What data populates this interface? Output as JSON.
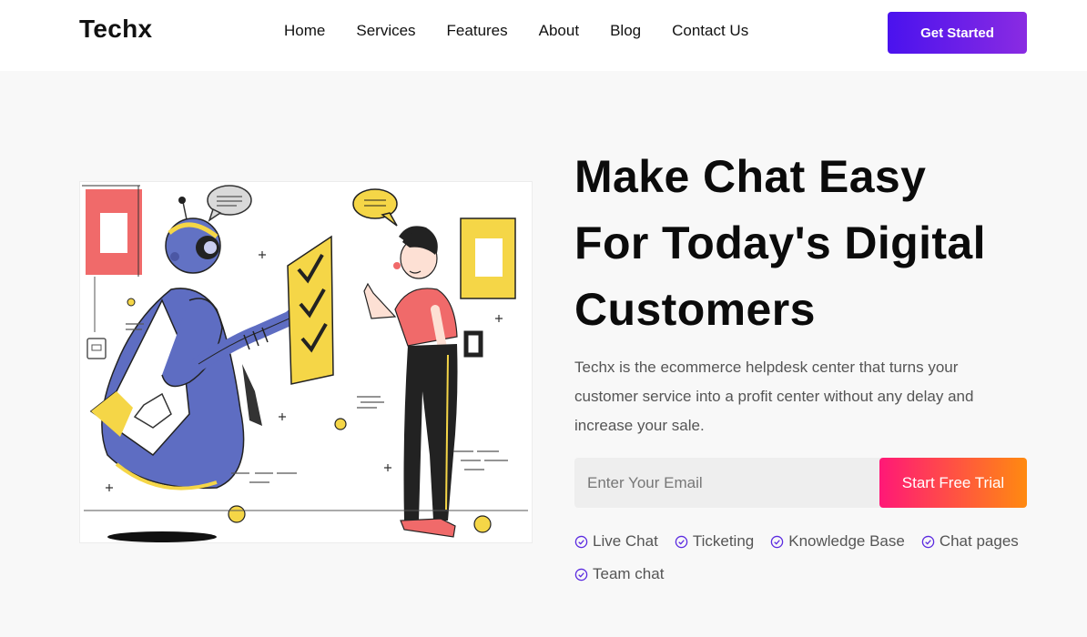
{
  "nav": {
    "logo": "Techx",
    "links": [
      "Home",
      "Services",
      "Features",
      "About",
      "Blog",
      "Contact Us"
    ],
    "cta": "Get Started"
  },
  "hero": {
    "title_lines": [
      "Make Chat Easy",
      "For Today's Digital",
      "Customers"
    ],
    "description": "Techx is the ecommerce helpdesk center that turns your customer service into a profit center without any delay and increase your sale.",
    "email_placeholder": "Enter Your Email",
    "trial_button": "Start Free Trial",
    "features": [
      "Live Chat",
      "Ticketing",
      "Knowledge Base",
      "Chat pages",
      "Team chat"
    ]
  },
  "colors": {
    "primary": "#4a12ee",
    "gradient_start": "#ff1877",
    "gradient_end": "#ff8a10",
    "check": "#5b2be0"
  },
  "icons": {
    "feature": "check-circle-icon"
  }
}
